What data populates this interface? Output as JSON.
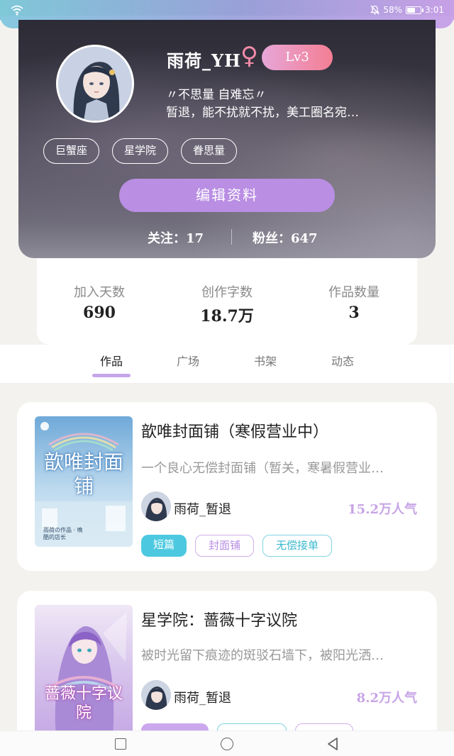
{
  "status_bar": {
    "battery": "58%",
    "time": "3:01"
  },
  "profile": {
    "username": "雨荷_YH",
    "gender_symbol": "♀",
    "level": "Lv3",
    "bio_line1": "〃不思量 自难忘〃",
    "bio_line2": "暂退，能不扰就不扰，美工圈名宛…",
    "tags": [
      "巨蟹座",
      "星学院",
      "眷思量"
    ],
    "edit_button": "编辑资料",
    "following_label": "关注：",
    "following_count": "17",
    "fans_label": "粉丝：",
    "fans_count": "647"
  },
  "stats": [
    {
      "label": "加入天数",
      "value": "690"
    },
    {
      "label": "创作字数",
      "value": "18.7万"
    },
    {
      "label": "作品数量",
      "value": "3"
    }
  ],
  "tabs": [
    {
      "label": "作品",
      "active": true
    },
    {
      "label": "广场",
      "active": false
    },
    {
      "label": "书架",
      "active": false
    },
    {
      "label": "动态",
      "active": false
    }
  ],
  "works": [
    {
      "title": "歆唯封面铺（寒假营业中）",
      "desc": "一个良心无偿封面铺（暂关，寒暑假营业…",
      "author": "雨荷_暂退",
      "popularity": "15.2万人气",
      "chips": [
        "短篇",
        "封面铺",
        "无偿接单"
      ],
      "cover_text": "歆唯封面铺",
      "cover_sub": "雨荷の作品 · 晚酷的店长"
    },
    {
      "title": "星学院：蔷薇十字议院",
      "desc": "被时光留下痕迹的斑驳石墙下，被阳光洒…",
      "author": "雨荷_暂退",
      "popularity": "8.2万人气",
      "chips": [
        "",
        "",
        ""
      ],
      "cover_text": "蔷薇十字议院"
    }
  ],
  "colors": {
    "accent_purple": "#b98ee3",
    "chip_cyan": "#4cc9e0",
    "popularity": "#c7a4e6",
    "level_badge": "#f37e93"
  }
}
